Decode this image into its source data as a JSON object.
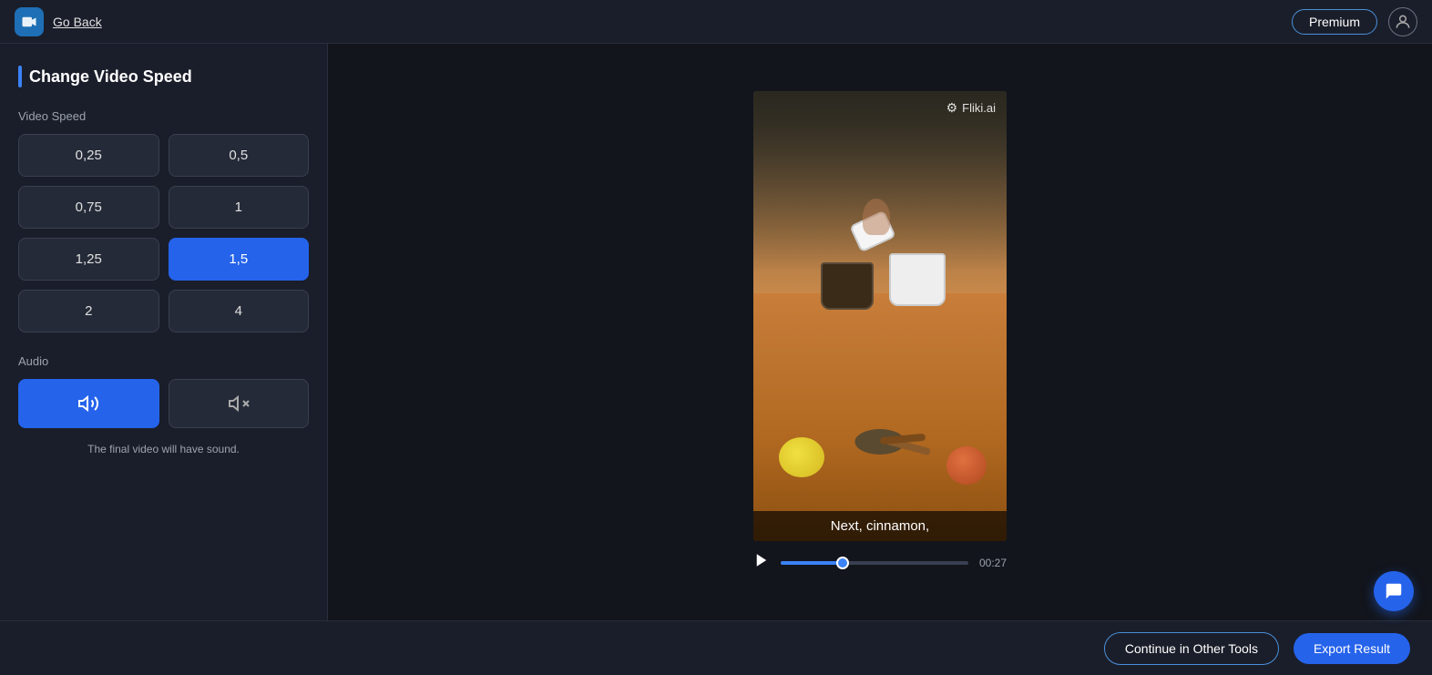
{
  "header": {
    "app_icon_label": "📹",
    "go_back_label": "Go Back",
    "premium_label": "Premium",
    "user_icon_label": "👤"
  },
  "sidebar": {
    "title": "Change Video Speed",
    "video_speed_label": "Video Speed",
    "speed_options": [
      {
        "value": "0,25",
        "active": false
      },
      {
        "value": "0,5",
        "active": false
      },
      {
        "value": "0,75",
        "active": false
      },
      {
        "value": "1",
        "active": false
      },
      {
        "value": "1,25",
        "active": false
      },
      {
        "value": "1,5",
        "active": true
      },
      {
        "value": "2",
        "active": false
      },
      {
        "value": "4",
        "active": false
      }
    ],
    "audio_label": "Audio",
    "audio_options": [
      {
        "icon": "🔊",
        "active": true
      },
      {
        "icon": "🔇",
        "active": false
      }
    ],
    "audio_note": "The final video will have sound."
  },
  "video": {
    "watermark": "Fliki.ai",
    "subtitle": "Next, cinnamon,",
    "time": "00:27",
    "progress_percent": 33
  },
  "footer": {
    "continue_label": "Continue in Other Tools",
    "export_label": "Export Result"
  },
  "chat": {
    "icon": "💬"
  }
}
